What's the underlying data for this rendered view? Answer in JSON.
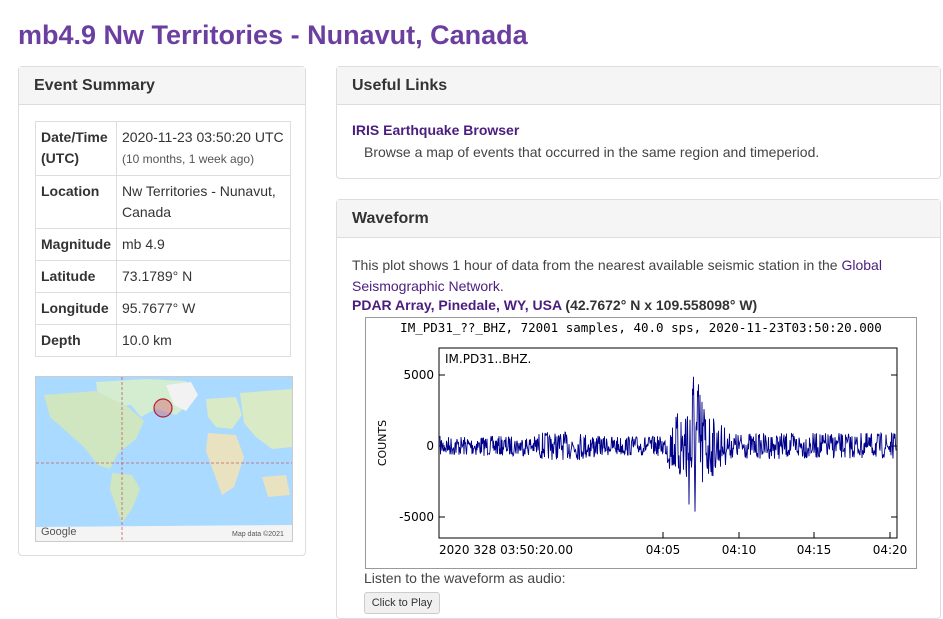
{
  "page": {
    "title": "mb4.9 Nw Territories - Nunavut, Canada"
  },
  "summary": {
    "heading": "Event Summary",
    "rows": [
      {
        "key": "Date/Time (UTC)",
        "value": "2020-11-23 03:50:20 UTC",
        "sub": "(10 months, 1 week ago)"
      },
      {
        "key": "Location",
        "value": "Nw Territories - Nunavut, Canada",
        "sub": ""
      },
      {
        "key": "Magnitude",
        "value": "mb 4.9",
        "sub": ""
      },
      {
        "key": "Latitude",
        "value": "73.1789° N",
        "sub": ""
      },
      {
        "key": "Longitude",
        "value": "95.7677° W",
        "sub": ""
      },
      {
        "key": "Depth",
        "value": "10.0 km",
        "sub": ""
      }
    ],
    "map": {
      "logo": "Google",
      "attribution": "Map data ©2021"
    }
  },
  "links": {
    "heading": "Useful Links",
    "iris_label": "IRIS Earthquake Browser",
    "iris_desc": "Browse a map of events that occurred in the same region and timeperiod."
  },
  "waveform": {
    "heading": "Waveform",
    "intro": "This plot shows 1 hour of data from the nearest available seismic station in the ",
    "network_link": "Global Seismographic Network",
    "intro_end": ".",
    "station_link": "PDAR Array, Pinedale, WY, USA",
    "station_coords": " (42.7672° N x 109.558098° W)",
    "plot_title": "IM_PD31_??_BHZ, 72001 samples, 40.0 sps, 2020-11-23T03:50:20.000",
    "trace_label": "IM.PD31..BHZ.",
    "y_label": "COUNTS",
    "y_ticks": [
      "5000",
      "0",
      "-5000"
    ],
    "x_ticks": [
      "2020 328 03:50:20.00",
      "04:05",
      "04:10",
      "04:15",
      "04:20"
    ],
    "audio_label": "Listen to the waveform as audio:",
    "play_label": "Click to Play"
  },
  "colors": {
    "title": "#6b3fa0",
    "link": "#4a1e7e",
    "trace": "#00008b"
  }
}
